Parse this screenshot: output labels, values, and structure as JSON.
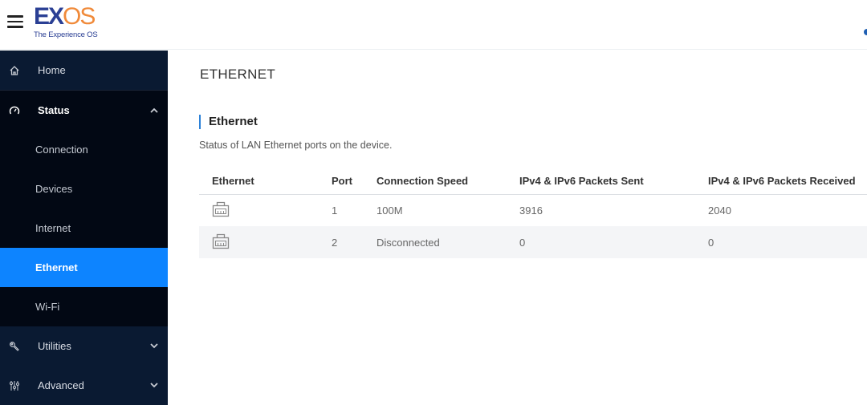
{
  "header": {
    "logo_primary_a": "EX",
    "logo_primary_b": "OS",
    "logo_tagline": "The Experience OS"
  },
  "sidebar": {
    "items": [
      {
        "label": "Home",
        "icon": "home-icon"
      },
      {
        "label": "Status",
        "icon": "gauge-icon",
        "expanded": true
      },
      {
        "label": "Connection"
      },
      {
        "label": "Devices"
      },
      {
        "label": "Internet"
      },
      {
        "label": "Ethernet",
        "active": true
      },
      {
        "label": "Wi-Fi"
      },
      {
        "label": "Utilities",
        "icon": "wrench-icon",
        "expanded": false
      },
      {
        "label": "Advanced",
        "icon": "sliders-icon",
        "expanded": false
      }
    ]
  },
  "main": {
    "page_title": "ETHERNET",
    "section_title": "Ethernet",
    "section_desc": "Status of LAN Ethernet ports on the device.",
    "table": {
      "headers": [
        "Ethernet",
        "Port",
        "Connection Speed",
        "IPv4 & IPv6 Packets Sent",
        "IPv4 & IPv6 Packets Received"
      ],
      "rows": [
        {
          "icon": "ethernet-port-icon",
          "port": "1",
          "speed": "100M",
          "sent": "3916",
          "received": "2040"
        },
        {
          "icon": "ethernet-port-icon",
          "port": "2",
          "speed": "Disconnected",
          "sent": "0",
          "received": "0"
        }
      ]
    }
  },
  "colors": {
    "accent": "#0d84ff",
    "sidebar_bg": "#020814",
    "logo_blue": "#2a3f94",
    "logo_orange": "#f08a3a"
  }
}
